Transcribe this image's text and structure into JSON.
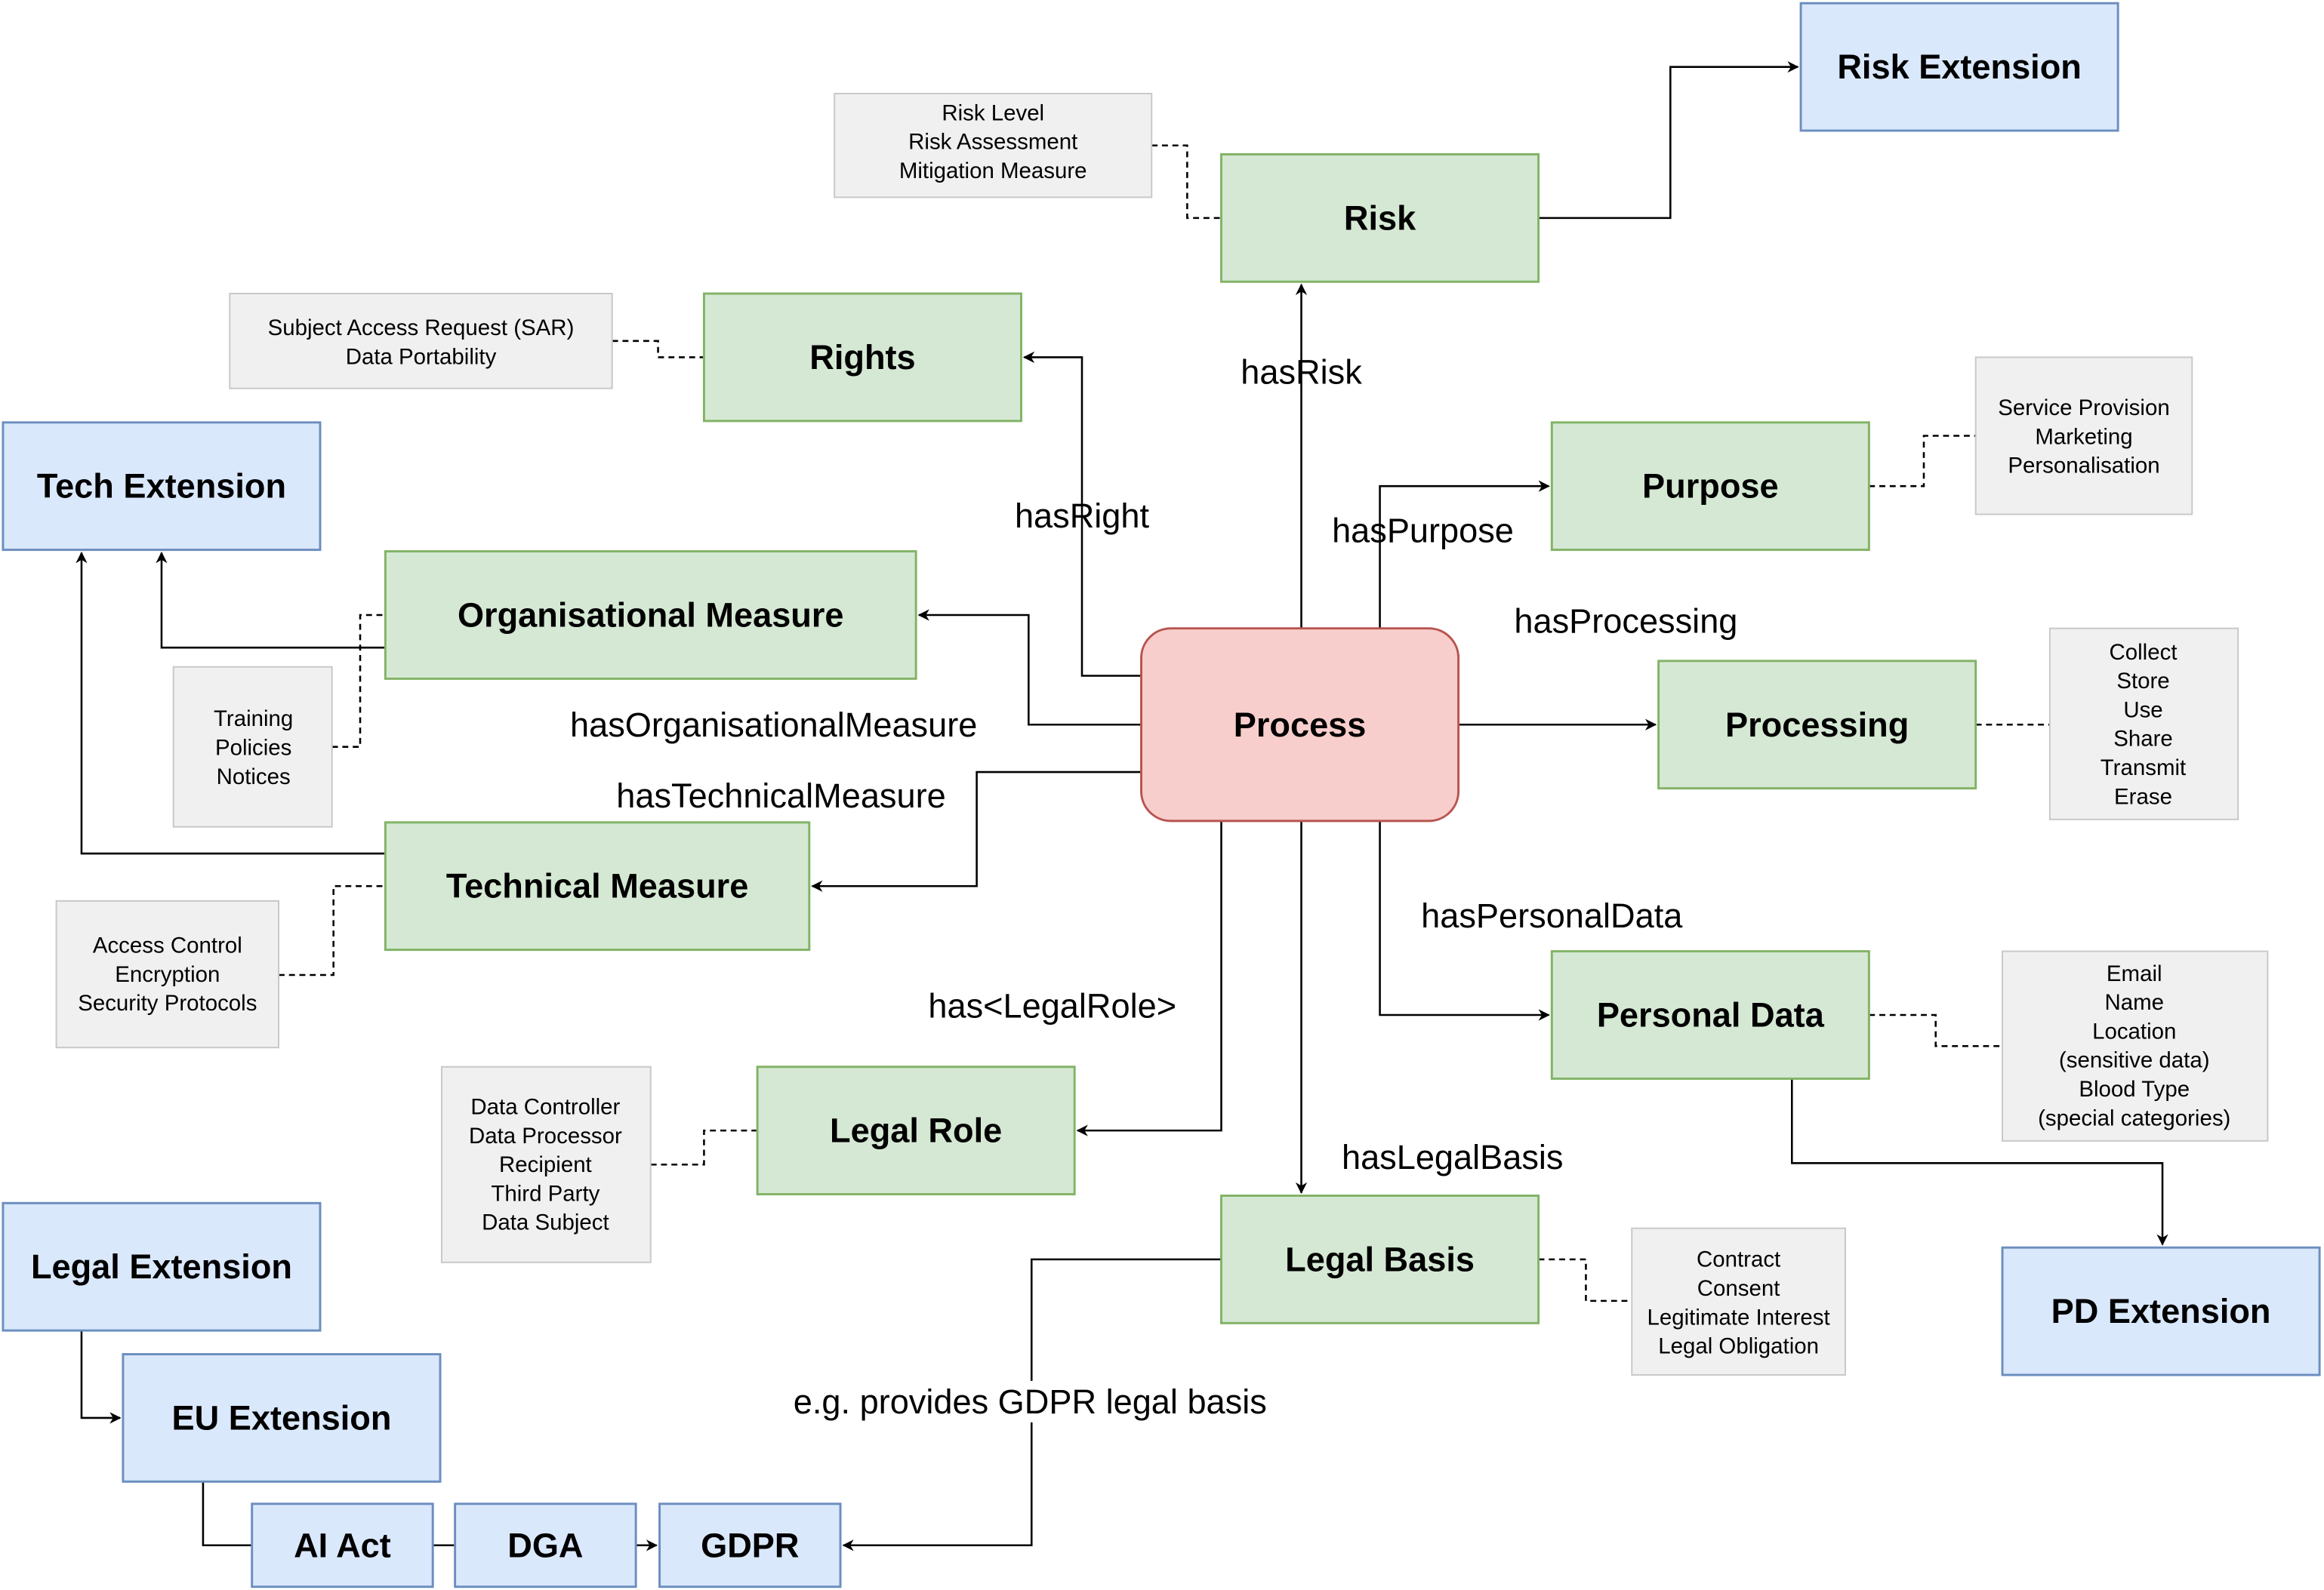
{
  "nodes": {
    "process": "Process",
    "risk": "Risk",
    "risk_extension": "Risk Extension",
    "rights": "Rights",
    "tech_extension": "Tech Extension",
    "purpose": "Purpose",
    "organisational_measure": "Organisational Measure",
    "processing": "Processing",
    "technical_measure": "Technical Measure",
    "personal_data": "Personal Data",
    "legal_role": "Legal Role",
    "legal_basis": "Legal Basis",
    "pd_extension": "PD Extension",
    "legal_extension": "Legal Extension",
    "eu_extension": "EU Extension",
    "ai_act": "AI Act",
    "dga": "DGA",
    "gdpr": "GDPR"
  },
  "notes": {
    "risk": [
      "Risk Level",
      "Risk Assessment",
      "Mitigation Measure"
    ],
    "rights": [
      "Subject Access Request (SAR)",
      "Data Portability"
    ],
    "purpose": [
      "Service Provision",
      "Marketing",
      "Personalisation"
    ],
    "organisational_measure": [
      "Training",
      "Policies",
      "Notices"
    ],
    "processing": [
      "Collect",
      "Store",
      "Use",
      "Share",
      "Transmit",
      "Erase"
    ],
    "technical_measure": [
      "Access Control",
      "Encryption",
      "Security Protocols"
    ],
    "personal_data": [
      "Email",
      "Name",
      "Location",
      "(sensitive data)",
      "Blood Type",
      "(special categories)"
    ],
    "legal_role": [
      "Data Controller",
      "Data Processor",
      "Recipient",
      "Third Party",
      "Data Subject"
    ],
    "legal_basis": [
      "Contract",
      "Consent",
      "Legitimate Interest",
      "Legal Obligation"
    ]
  },
  "edges": {
    "has_risk": "hasRisk",
    "has_right": "hasRight",
    "has_purpose": "hasPurpose",
    "has_organisational_measure": "hasOrganisationalMeasure",
    "has_technical_measure": "hasTechnicalMeasure",
    "has_processing": "hasProcessing",
    "has_personal_data": "hasPersonalData",
    "has_legal_role": "has<LegalRole>",
    "has_legal_basis": "hasLegalBasis",
    "gdpr_legal_basis": "e.g. provides GDPR legal basis"
  },
  "colors": {
    "concept_fill": "#d5e8d4",
    "concept_stroke": "#82b366",
    "extension_fill": "#dae8fc",
    "extension_stroke": "#6c8ebf",
    "process_fill": "#f8cecc",
    "process_stroke": "#b85450",
    "note_fill": "#f0f0f0"
  }
}
